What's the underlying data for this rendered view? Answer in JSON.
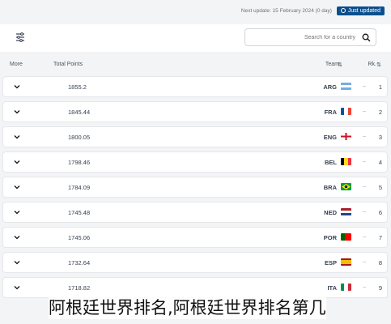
{
  "header_bar": {
    "badge_label": "Just updated",
    "next_update": "Next update: 15 February 2024 (0 day)"
  },
  "search": {
    "placeholder": "Search for a country"
  },
  "columns": {
    "more": "More",
    "total_points": "Total Points",
    "team": "Team",
    "rank": "Rk."
  },
  "rows": [
    {
      "rank": "1",
      "team": "ARG",
      "points": "1855.2",
      "flag": "arg"
    },
    {
      "rank": "2",
      "team": "FRA",
      "points": "1845.44",
      "flag": "fra"
    },
    {
      "rank": "3",
      "team": "ENG",
      "points": "1800.05",
      "flag": "eng"
    },
    {
      "rank": "4",
      "team": "BEL",
      "points": "1798.46",
      "flag": "bel"
    },
    {
      "rank": "5",
      "team": "BRA",
      "points": "1784.09",
      "flag": "bra"
    },
    {
      "rank": "6",
      "team": "NED",
      "points": "1745.48",
      "flag": "ned"
    },
    {
      "rank": "7",
      "team": "POR",
      "points": "1745.06",
      "flag": "por"
    },
    {
      "rank": "8",
      "team": "ESP",
      "points": "1732.64",
      "flag": "esp"
    },
    {
      "rank": "9",
      "team": "ITA",
      "points": "1718.82",
      "flag": "ita"
    }
  ],
  "caption": "阿根廷世界排名,阿根廷世界排名第几",
  "colors": {
    "badge": "#0b4f8c",
    "row_bg": "#ffffff",
    "page_bg": "#f3f4f6"
  }
}
